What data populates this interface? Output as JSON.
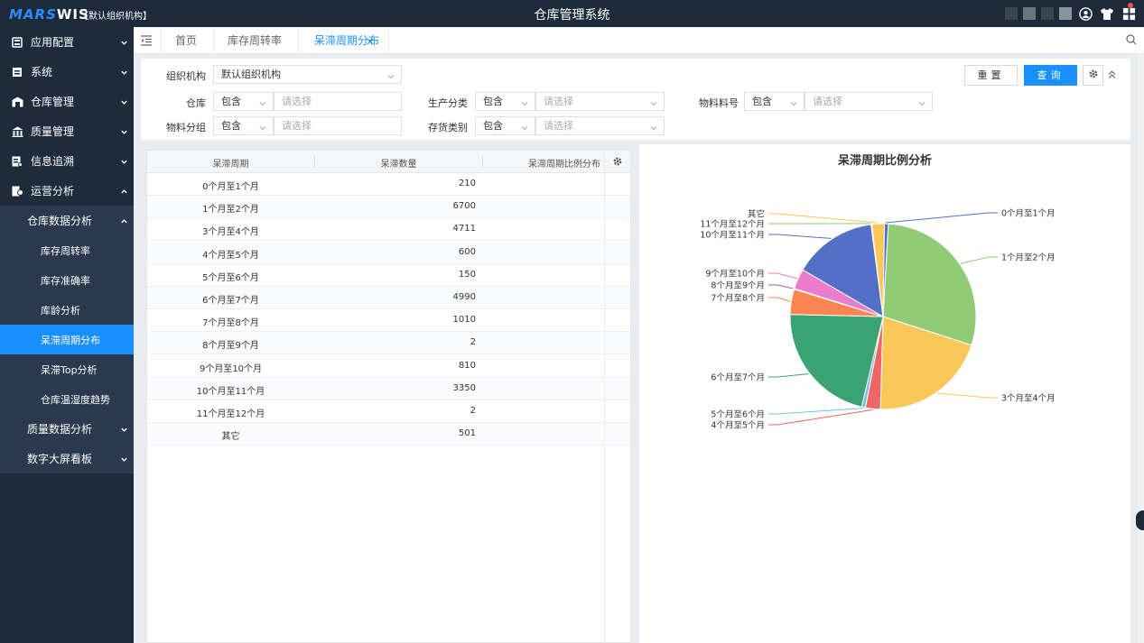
{
  "header": {
    "logo_part_a": "MARS",
    "logo_part_b": "WIS",
    "org": "【默认组织机构】",
    "title": "仓库管理系统"
  },
  "sidebar": {
    "items": [
      {
        "label": "应用配置",
        "icon": "app-config-icon"
      },
      {
        "label": "系统",
        "icon": "system-icon"
      },
      {
        "label": "仓库管理",
        "icon": "warehouse-icon"
      },
      {
        "label": "质量管理",
        "icon": "quality-icon"
      },
      {
        "label": "信息追溯",
        "icon": "trace-icon"
      },
      {
        "label": "运营分析",
        "icon": "analysis-icon"
      }
    ],
    "sub_group": "仓库数据分析",
    "sub_items": [
      "库存周转率",
      "库存准确率",
      "库龄分析",
      "呆滞周期分布",
      "呆滞Top分析",
      "仓库温湿度趋势"
    ],
    "after_items": [
      "质量数据分析",
      "数字大屏看板"
    ]
  },
  "tabs": [
    {
      "label": "首页"
    },
    {
      "label": "库存周转率"
    },
    {
      "label": "呆滞周期分布"
    }
  ],
  "filter": {
    "org_label": "组织机构",
    "org_value": "默认组织机构",
    "warehouse_label": "仓库",
    "category_label": "生产分类",
    "material_label": "物料料号",
    "group_label": "物料分组",
    "stock_label": "存货类别",
    "contains": "包含",
    "placeholder": "请选择",
    "reset": "重置",
    "query": "查询"
  },
  "table": {
    "headers": [
      "呆滞周期",
      "呆滞数量",
      "呆滞周期比例分布"
    ],
    "rows": [
      {
        "period": "0个月至1个月",
        "qty": "210"
      },
      {
        "period": "1个月至2个月",
        "qty": "6700"
      },
      {
        "period": "3个月至4个月",
        "qty": "4711"
      },
      {
        "period": "4个月至5个月",
        "qty": "600"
      },
      {
        "period": "5个月至6个月",
        "qty": "150"
      },
      {
        "period": "6个月至7个月",
        "qty": "4990"
      },
      {
        "period": "7个月至8个月",
        "qty": "1010"
      },
      {
        "period": "8个月至9个月",
        "qty": "2"
      },
      {
        "period": "9个月至10个月",
        "qty": "810"
      },
      {
        "period": "10个月至11个月",
        "qty": "3350"
      },
      {
        "period": "11个月至12个月",
        "qty": "2"
      },
      {
        "period": "其它",
        "qty": "501"
      }
    ]
  },
  "chart_data": {
    "type": "pie",
    "title": "呆滞周期比例分析",
    "categories": [
      "0个月至1个月",
      "1个月至2个月",
      "3个月至4个月",
      "4个月至5个月",
      "5个月至6个月",
      "6个月至7个月",
      "7个月至8个月",
      "8个月至9个月",
      "9个月至10个月",
      "10个月至11个月",
      "11个月至12个月",
      "其它"
    ],
    "values": [
      210,
      6700,
      4711,
      600,
      150,
      4990,
      1010,
      2,
      810,
      3350,
      2,
      501
    ],
    "colors": [
      "#5470c6",
      "#91cc75",
      "#fac858",
      "#ee6666",
      "#73c0de",
      "#3ba272",
      "#fc8452",
      "#9a60b4",
      "#ea7ccc",
      "#5470c6",
      "#91cc75",
      "#fac858"
    ]
  }
}
